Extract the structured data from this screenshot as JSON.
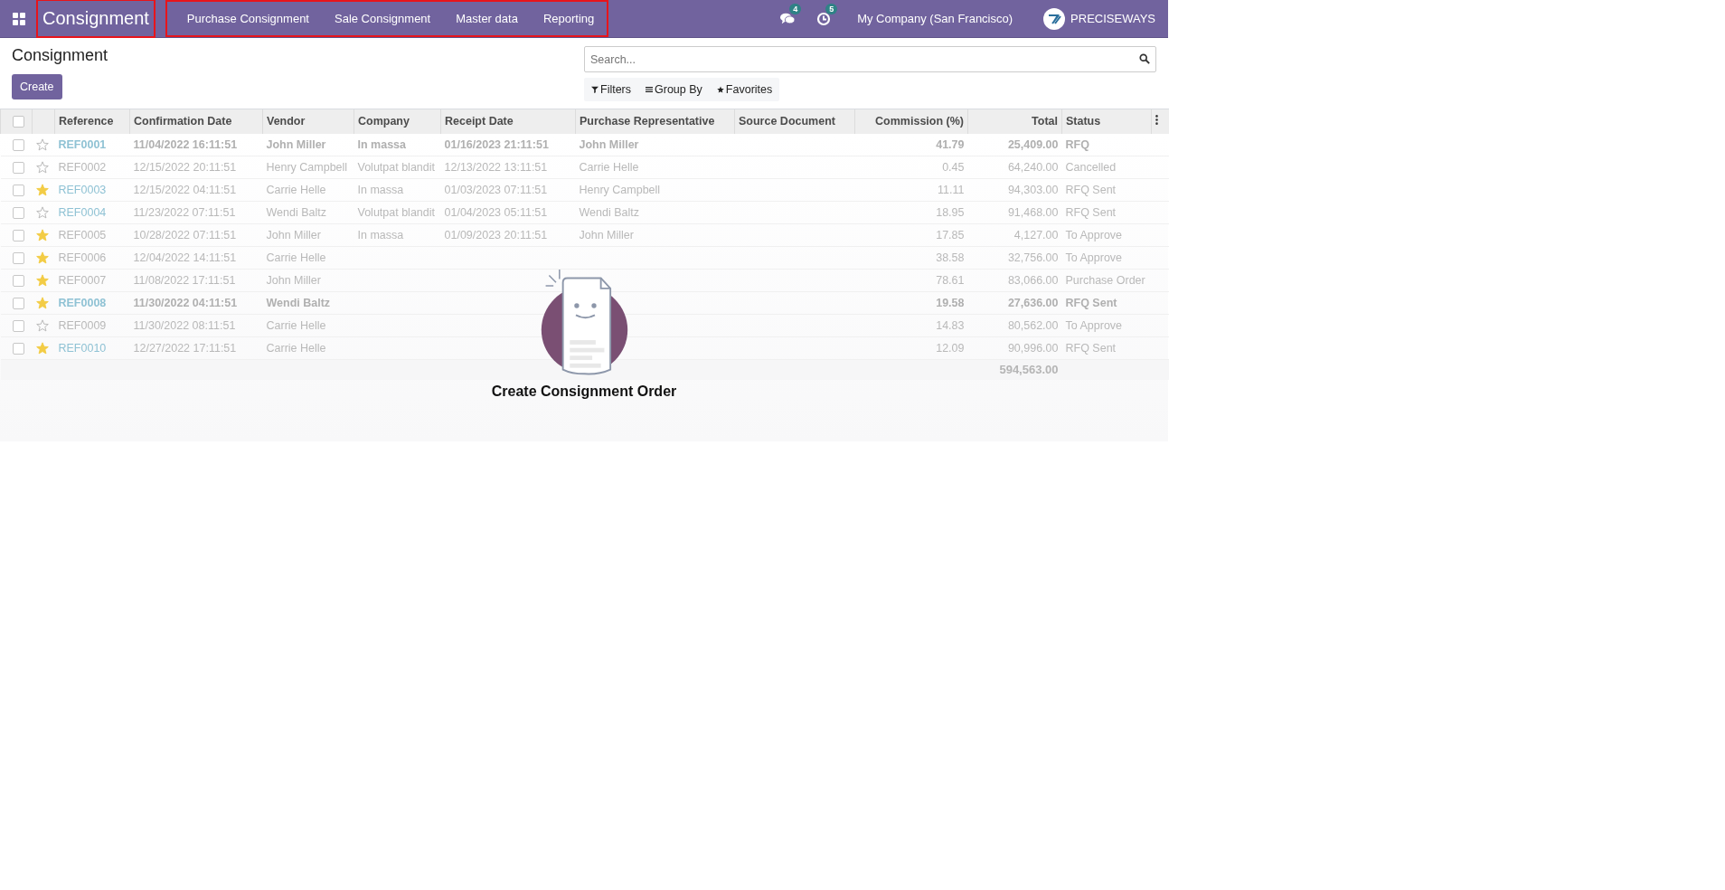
{
  "navbar": {
    "brand": {
      "label": "Consignment",
      "highlighted": true
    },
    "menu": {
      "highlighted": true,
      "items": [
        "Purchase Consignment",
        "Sale Consignment",
        "Master data",
        "Reporting"
      ]
    },
    "messages_badge": "4",
    "activities_badge": "5",
    "company": "My Company (San Francisco)",
    "user": "PRECISEWAYS"
  },
  "control_panel": {
    "title": "Consignment",
    "create_button": "Create",
    "search": {
      "placeholder": "Search..."
    },
    "filters": [
      "Filters",
      "Group By",
      "Favorites"
    ]
  },
  "table": {
    "select_all_checked": false,
    "columns": [
      "Reference",
      "Confirmation Date",
      "Vendor",
      "Company",
      "Receipt Date",
      "Purchase Representative",
      "Source Document",
      "Commission (%)",
      "Total",
      "Status"
    ],
    "rows": [
      {
        "checked": false,
        "starred": false,
        "link": true,
        "bold": true,
        "reference": "REF0001",
        "confirmation_date": "11/04/2022 16:11:51",
        "vendor": "John Miller",
        "company": "In massa",
        "receipt_date": "01/16/2023 21:11:51",
        "representative": "John Miller",
        "commission": "41.79",
        "total": "25,409.00",
        "status": "RFQ"
      },
      {
        "checked": false,
        "starred": false,
        "link": false,
        "bold": false,
        "reference": "REF0002",
        "confirmation_date": "12/15/2022 20:11:51",
        "vendor": "Henry Campbell",
        "company": "Volutpat blandit",
        "receipt_date": "12/13/2022 13:11:51",
        "representative": "Carrie Helle",
        "commission": "0.45",
        "total": "64,240.00",
        "status": "Cancelled"
      },
      {
        "checked": false,
        "starred": true,
        "link": true,
        "bold": false,
        "reference": "REF0003",
        "confirmation_date": "12/15/2022 04:11:51",
        "vendor": "Carrie Helle",
        "company": "In massa",
        "receipt_date": "01/03/2023 07:11:51",
        "representative": "Henry Campbell",
        "commission": "11.11",
        "total": "94,303.00",
        "status": "RFQ Sent"
      },
      {
        "checked": false,
        "starred": false,
        "link": true,
        "bold": false,
        "reference": "REF0004",
        "confirmation_date": "11/23/2022 07:11:51",
        "vendor": "Wendi Baltz",
        "company": "Volutpat blandit",
        "receipt_date": "01/04/2023 05:11:51",
        "representative": "Wendi Baltz",
        "commission": "18.95",
        "total": "91,468.00",
        "status": "RFQ Sent"
      },
      {
        "checked": false,
        "starred": true,
        "link": false,
        "bold": false,
        "reference": "REF0005",
        "confirmation_date": "10/28/2022 07:11:51",
        "vendor": "John Miller",
        "company": "In massa",
        "receipt_date": "01/09/2023 20:11:51",
        "representative": "John Miller",
        "commission": "17.85",
        "total": "4,127.00",
        "status": "To Approve"
      },
      {
        "checked": false,
        "starred": true,
        "link": false,
        "bold": false,
        "reference": "REF0006",
        "confirmation_date": "12/04/2022 14:11:51",
        "vendor": "Carrie Helle",
        "commission": "38.58",
        "total": "32,756.00",
        "status": "To Approve"
      },
      {
        "checked": false,
        "starred": true,
        "link": false,
        "bold": false,
        "reference": "REF0007",
        "confirmation_date": "11/08/2022 17:11:51",
        "vendor": "John Miller",
        "commission": "78.61",
        "total": "83,066.00",
        "status": "Purchase Order"
      },
      {
        "checked": false,
        "starred": true,
        "link": true,
        "bold": true,
        "reference": "REF0008",
        "confirmation_date": "11/30/2022 04:11:51",
        "vendor": "Wendi Baltz",
        "commission": "19.58",
        "total": "27,636.00",
        "status": "RFQ Sent"
      },
      {
        "checked": false,
        "starred": false,
        "link": false,
        "bold": false,
        "reference": "REF0009",
        "confirmation_date": "11/30/2022 08:11:51",
        "vendor": "Carrie Helle",
        "commission": "14.83",
        "total": "80,562.00",
        "status": "To Approve"
      },
      {
        "checked": false,
        "starred": true,
        "link": true,
        "bold": false,
        "reference": "REF0010",
        "confirmation_date": "12/27/2022 17:11:51",
        "vendor": "Carrie Helle",
        "commission": "12.09",
        "total": "90,996.00",
        "status": "RFQ Sent"
      }
    ],
    "sum_total": "594,563.00"
  },
  "helper": {
    "title": "Create Consignment Order"
  }
}
